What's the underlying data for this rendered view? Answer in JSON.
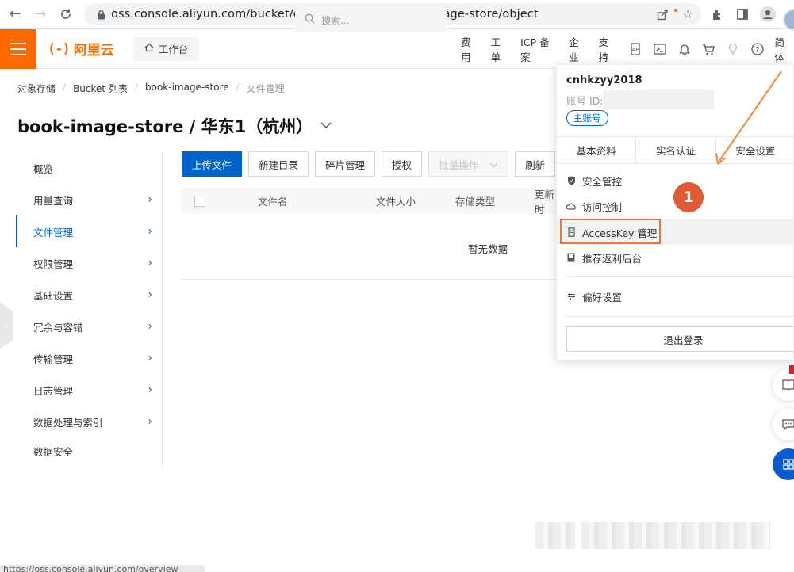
{
  "browser": {
    "url": "oss.console.aliyun.com/bucket/oss-cn-hangzhou/book-image-store/object",
    "status_url": "https://oss.console.aliyun.com/overview"
  },
  "topbar": {
    "brand": "阿里云",
    "brand_mark": "(-)",
    "workbench": "工作台",
    "search_placeholder": "搜索...",
    "links": [
      "费用",
      "工单",
      "ICP 备案",
      "企业",
      "支持"
    ],
    "lang": "简体"
  },
  "breadcrumb": [
    "对象存储",
    "Bucket 列表",
    "book-image-store",
    "文件管理"
  ],
  "title": "book-image-store / 华东1（杭州）",
  "sidebar": {
    "items": [
      {
        "label": "概览"
      },
      {
        "label": "用量查询"
      },
      {
        "label": "文件管理"
      },
      {
        "label": "权限管理"
      },
      {
        "label": "基础设置"
      },
      {
        "label": "冗余与容错"
      },
      {
        "label": "传输管理"
      },
      {
        "label": "日志管理"
      },
      {
        "label": "数据处理与索引"
      },
      {
        "label": "数据安全"
      }
    ]
  },
  "toolbar": {
    "upload": "上传文件",
    "new_dir": "新建目录",
    "fragments": "碎片管理",
    "authorize": "授权",
    "batch": "批量操作",
    "refresh": "刷新"
  },
  "table": {
    "columns": [
      "文件名",
      "文件大小",
      "存储类型",
      "更新时"
    ],
    "empty": "暂无数据"
  },
  "account_panel": {
    "username": "cnhkzyy2018",
    "id_label": "账号 ID:",
    "badge": "主账号",
    "tabs": [
      "基本资料",
      "实名认证",
      "安全设置"
    ],
    "menu": [
      {
        "label": "安全管控"
      },
      {
        "label": "访问控制"
      },
      {
        "label": "AccessKey 管理"
      },
      {
        "label": "推荐返利后台"
      },
      {
        "label": "偏好设置"
      }
    ],
    "logout": "退出登录"
  },
  "annotation": {
    "step": "1"
  }
}
